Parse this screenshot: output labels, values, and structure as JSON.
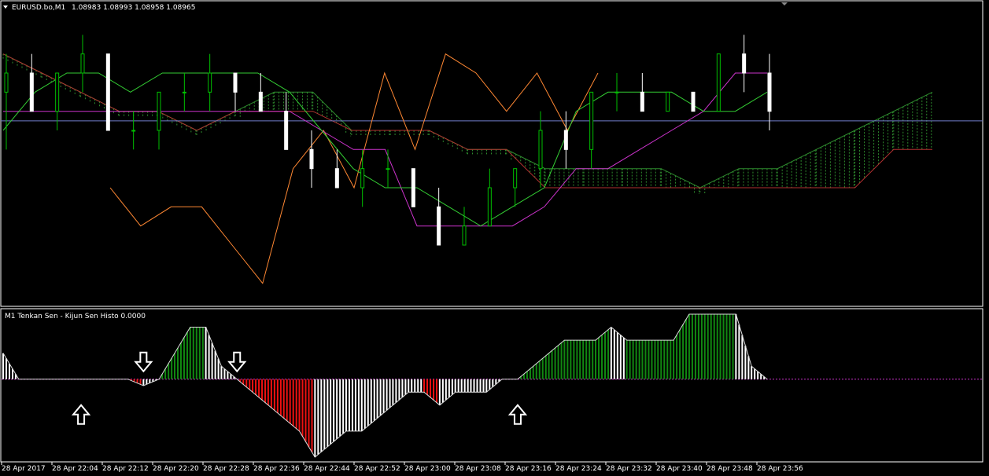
{
  "window": {
    "symbol_label": "EURUSD.bo,M1",
    "ohlc_label": "1.08983 1.08993 1.08958 1.08965",
    "indicator_label": "M1  Tenkan Sen - Kijun Sen Histo 0.0000"
  },
  "colors": {
    "background": "#000000",
    "grid": "#ffffff",
    "bull_candle": "#00c000",
    "bear_candle": "#ffffff",
    "tenkan": "#33cc33",
    "kijun": "#cc33cc",
    "chikou": "#ff8833",
    "kumo_up": "#2e8b2e",
    "kumo_down": "#b03030",
    "histo_up": "#118811",
    "histo_down": "#ee1111",
    "histo_neutral": "#ffffff",
    "price_line": "#6f7cc9",
    "zero_line": "#cc33cc",
    "arrow_fill": "#ffffff"
  },
  "icons": {
    "down_arrow": "down-arrow-icon",
    "up_arrow": "up-arrow-icon",
    "menu_triangle": "triangle-down-icon"
  },
  "chart_data": [
    {
      "type": "candlestick",
      "title": "EURUSD.bo,M1",
      "x_tick_labels": [
        "28 Apr 2017",
        "28 Apr 22:04",
        "28 Apr 22:12",
        "28 Apr 22:20",
        "28 Apr 22:28",
        "28 Apr 22:36",
        "28 Apr 22:44",
        "28 Apr 22:52",
        "28 Apr 23:00",
        "28 Apr 23:08",
        "28 Apr 23:16",
        "28 Apr 23:24",
        "28 Apr 23:32",
        "28 Apr 23:40",
        "28 Apr 23:48",
        "28 Apr 23:56"
      ],
      "current_price": 1.08965,
      "ylim": [
        1.0887,
        1.0902
      ],
      "tenkan": [
        1.0896,
        1.0898,
        1.0899,
        1.0899,
        1.0898,
        1.0899,
        1.0899,
        1.0899,
        1.0899,
        1.0898,
        1.0896,
        1.0894,
        1.0893,
        1.0893,
        1.0892,
        1.0891,
        1.0892,
        1.0893,
        1.0897,
        1.0898,
        1.0898,
        1.0898,
        1.0897,
        1.0897,
        1.0898
      ],
      "kijun": [
        1.0897,
        1.0897,
        1.0897,
        1.0897,
        1.0897,
        1.0897,
        1.0897,
        1.0897,
        1.0897,
        1.0897,
        1.0896,
        1.0895,
        1.0895,
        1.0891,
        1.0891,
        1.0891,
        1.0891,
        1.0892,
        1.0894,
        1.0894,
        1.0895,
        1.0896,
        1.0897,
        1.0899,
        1.0899
      ],
      "chikou": [
        1.0893,
        1.0891,
        1.0892,
        1.0892,
        1.089,
        1.0888,
        1.0894,
        1.0896,
        1.0893,
        1.0899,
        1.0895,
        1.09,
        1.0899,
        1.0897,
        1.0899,
        1.0896,
        1.0899
      ],
      "senkou_a": [
        1.09,
        1.0899,
        1.0898,
        1.0897,
        1.0897,
        1.0896,
        1.0897,
        1.0898,
        1.0898,
        1.0896,
        1.0896,
        1.0896,
        1.0895,
        1.0895,
        1.0894,
        1.0894,
        1.0894,
        1.0894,
        1.0893,
        1.0894,
        1.0894,
        1.0895,
        1.0896,
        1.0897,
        1.0898
      ],
      "senkou_b": [
        1.09,
        1.0899,
        1.0898,
        1.0897,
        1.0897,
        1.0896,
        1.0897,
        1.0897,
        1.0897,
        1.0896,
        1.0896,
        1.0896,
        1.0895,
        1.0895,
        1.0893,
        1.0893,
        1.0893,
        1.0893,
        1.0893,
        1.0893,
        1.0893,
        1.0893,
        1.0893,
        1.0895,
        1.0895
      ],
      "candles": [
        {
          "o": 1.0898,
          "h": 1.09,
          "l": 1.0895,
          "c": 1.0899
        },
        {
          "o": 1.0899,
          "h": 1.09,
          "l": 1.0897,
          "c": 1.0897
        },
        {
          "o": 1.0897,
          "h": 1.0899,
          "l": 1.0896,
          "c": 1.0899
        },
        {
          "o": 1.0899,
          "h": 1.0901,
          "l": 1.0898,
          "c": 1.09
        },
        {
          "o": 1.09,
          "h": 1.09,
          "l": 1.0896,
          "c": 1.0896
        },
        {
          "o": 1.0896,
          "h": 1.0897,
          "l": 1.0895,
          "c": 1.0896
        },
        {
          "o": 1.0896,
          "h": 1.0898,
          "l": 1.0895,
          "c": 1.0898
        },
        {
          "o": 1.0898,
          "h": 1.0899,
          "l": 1.0897,
          "c": 1.0898
        },
        {
          "o": 1.0898,
          "h": 1.09,
          "l": 1.0897,
          "c": 1.0899
        },
        {
          "o": 1.0899,
          "h": 1.0899,
          "l": 1.0897,
          "c": 1.0898
        },
        {
          "o": 1.0898,
          "h": 1.0899,
          "l": 1.0897,
          "c": 1.0897
        },
        {
          "o": 1.0897,
          "h": 1.0898,
          "l": 1.0895,
          "c": 1.0895
        },
        {
          "o": 1.0895,
          "h": 1.0896,
          "l": 1.0893,
          "c": 1.0894
        },
        {
          "o": 1.0894,
          "h": 1.0895,
          "l": 1.0893,
          "c": 1.0893
        },
        {
          "o": 1.0893,
          "h": 1.0895,
          "l": 1.0892,
          "c": 1.0894
        },
        {
          "o": 1.0894,
          "h": 1.0895,
          "l": 1.0893,
          "c": 1.0894
        },
        {
          "o": 1.0894,
          "h": 1.0894,
          "l": 1.0892,
          "c": 1.0892
        },
        {
          "o": 1.0892,
          "h": 1.0893,
          "l": 1.089,
          "c": 1.089
        },
        {
          "o": 1.089,
          "h": 1.0892,
          "l": 1.089,
          "c": 1.0891
        },
        {
          "o": 1.0891,
          "h": 1.0894,
          "l": 1.0891,
          "c": 1.0893
        },
        {
          "o": 1.0893,
          "h": 1.0894,
          "l": 1.0892,
          "c": 1.0894
        },
        {
          "o": 1.0894,
          "h": 1.0897,
          "l": 1.0893,
          "c": 1.0896
        },
        {
          "o": 1.0896,
          "h": 1.0897,
          "l": 1.0894,
          "c": 1.0895
        },
        {
          "o": 1.0895,
          "h": 1.0898,
          "l": 1.0894,
          "c": 1.0898
        },
        {
          "o": 1.0898,
          "h": 1.0899,
          "l": 1.0897,
          "c": 1.0898
        },
        {
          "o": 1.0898,
          "h": 1.0899,
          "l": 1.0897,
          "c": 1.0897
        },
        {
          "o": 1.0897,
          "h": 1.0898,
          "l": 1.0897,
          "c": 1.0898
        },
        {
          "o": 1.0898,
          "h": 1.0898,
          "l": 1.0897,
          "c": 1.0897
        },
        {
          "o": 1.0897,
          "h": 1.09,
          "l": 1.0897,
          "c": 1.09
        },
        {
          "o": 1.09,
          "h": 1.0901,
          "l": 1.0898,
          "c": 1.0899
        },
        {
          "o": 1.0899,
          "h": 1.09,
          "l": 1.0896,
          "c": 1.0897
        }
      ]
    },
    {
      "type": "histogram",
      "title": "Tenkan Sen - Kijun Sen Histo",
      "current_value": 0.0,
      "ylim": [
        -0.0006,
        0.0005
      ],
      "values": [
        0.0002,
        0.0,
        0.0,
        0.0,
        0.0,
        0.0,
        0.0,
        0.0,
        0.0,
        -5e-05,
        0.0,
        0.0002,
        0.0004,
        0.0004,
        0.0001,
        0.0,
        -0.0001,
        -0.0002,
        -0.0003,
        -0.0004,
        -0.0006,
        -0.0005,
        -0.0004,
        -0.0004,
        -0.0003,
        -0.0002,
        -0.0001,
        -0.0001,
        -0.0002,
        -0.0001,
        -0.0001,
        -0.0001,
        0.0,
        0.0,
        0.0001,
        0.0002,
        0.0003,
        0.0003,
        0.0003,
        0.0004,
        0.0003,
        0.0003,
        0.0003,
        0.0003,
        0.0005,
        0.0005,
        0.0005,
        0.0005,
        0.0001,
        0.0
      ],
      "arrows": [
        {
          "direction": "down",
          "bar": 9
        },
        {
          "direction": "down",
          "bar": 15
        },
        {
          "direction": "up",
          "bar": 5
        },
        {
          "direction": "up",
          "bar": 33
        }
      ]
    }
  ]
}
